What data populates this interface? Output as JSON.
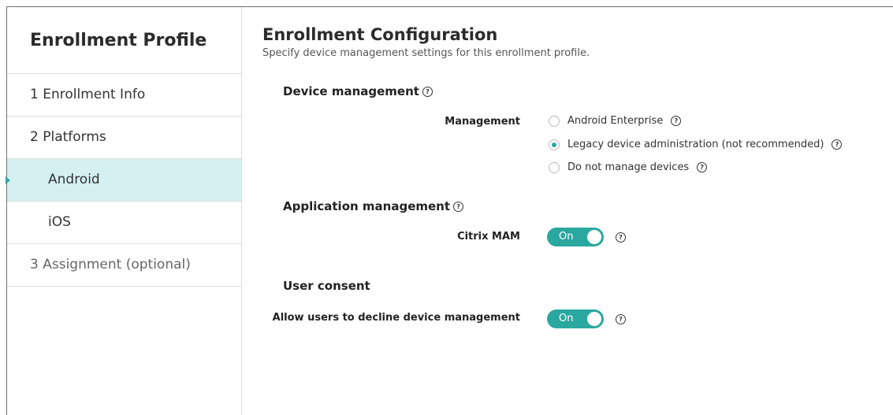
{
  "sidebar": {
    "title": "Enrollment Profile",
    "items": [
      {
        "label": "1  Enrollment Info"
      },
      {
        "label": "2  Platforms"
      },
      {
        "label": "Android"
      },
      {
        "label": "iOS"
      },
      {
        "label": "3  Assignment (optional)"
      }
    ]
  },
  "main": {
    "title": "Enrollment Configuration",
    "description": "Specify device management settings for this enrollment profile.",
    "device_management": {
      "heading": "Device management",
      "management_label": "Management",
      "options": [
        {
          "label": "Android Enterprise",
          "selected": false
        },
        {
          "label": "Legacy device administration (not recommended)",
          "selected": true
        },
        {
          "label": "Do not manage devices",
          "selected": false
        }
      ]
    },
    "application_management": {
      "heading": "Application management",
      "citrix_mam_label": "Citrix MAM",
      "citrix_mam_value": "On"
    },
    "user_consent": {
      "heading": "User consent",
      "decline_label": "Allow users to decline device management",
      "decline_value": "On"
    },
    "help_glyph": "?"
  },
  "colors": {
    "accent": "#2aa8a0",
    "active_nav_bg": "#d4f0f0",
    "border": "#dcdcdc"
  }
}
